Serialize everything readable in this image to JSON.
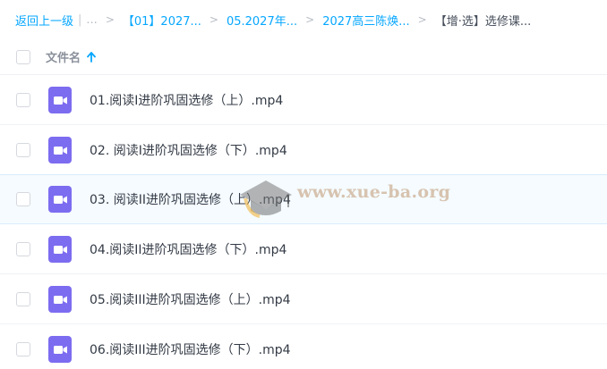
{
  "breadcrumb": {
    "back": "返回上一级",
    "divider": "|",
    "ellipsis": "...",
    "separator": ">",
    "items": [
      "【01】2027...",
      "05.2027年...",
      "2027高三陈焕..."
    ],
    "current": "【增·选】选修课..."
  },
  "header": {
    "column_label": "文件名",
    "sort_icon": "arrow-up-icon"
  },
  "files": [
    {
      "name": "01.阅读I进阶巩固选修（上）.mp4",
      "icon": "video-file-icon"
    },
    {
      "name": "02. 阅读I进阶巩固选修（下）.mp4",
      "icon": "video-file-icon"
    },
    {
      "name": "03. 阅读II进阶巩固选修（上）.mp4",
      "icon": "video-file-icon"
    },
    {
      "name": "04.阅读II进阶巩固选修（下）.mp4",
      "icon": "video-file-icon"
    },
    {
      "name": "05.阅读III进阶巩固选修（上）.mp4",
      "icon": "video-file-icon"
    },
    {
      "name": "06.阅读III进阶巩固选修（下）.mp4",
      "icon": "video-file-icon"
    }
  ],
  "watermark": {
    "text": "www.xue-ba.org"
  },
  "colors": {
    "link": "#06a7ff",
    "icon": "#7c6cf0",
    "hover_row": "#f5fbff"
  }
}
